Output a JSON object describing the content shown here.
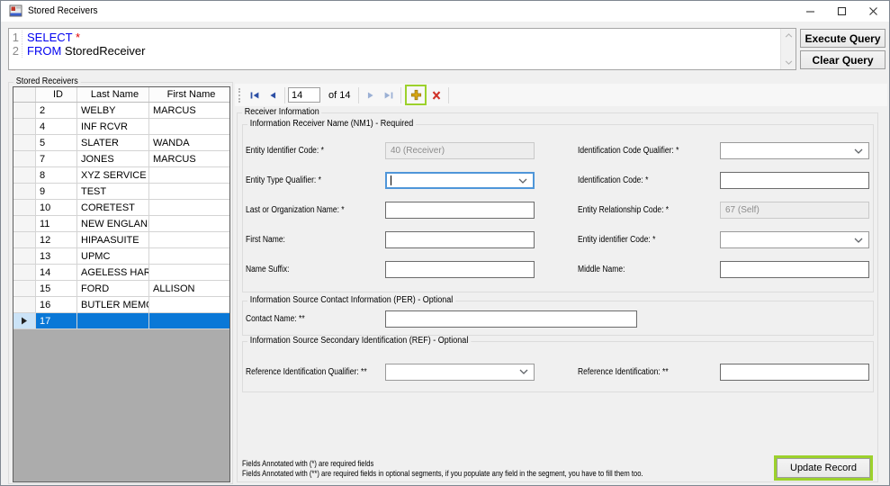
{
  "window": {
    "title": "Stored Receivers"
  },
  "colors": {
    "selection_blue": "#0a78d7",
    "highlight_green": "#9cd12c",
    "nav_arrow_blue": "#2d4fa5",
    "nav_arrow_disabled": "#9bb0d4",
    "add_gold": "#dba812",
    "delete_red": "#d03228",
    "keyword_blue": "#0000f0",
    "star_red": "#e00000"
  },
  "query": {
    "lines": [
      {
        "num": "1",
        "parts": [
          {
            "t": "SELECT",
            "c": "keyword"
          },
          {
            "t": " *",
            "c": "star"
          }
        ]
      },
      {
        "num": "2",
        "parts": [
          {
            "t": "FROM",
            "c": "keyword"
          },
          {
            "t": " StoredReceiver",
            "c": "plain"
          }
        ]
      }
    ],
    "execute_label": "Execute Query",
    "clear_label": "Clear Query"
  },
  "grid": {
    "group_label": "Stored Receivers",
    "columns": [
      "ID",
      "Last Name",
      "First Name"
    ],
    "rows": [
      {
        "id": "2",
        "last": "WELBY",
        "first": "MARCUS"
      },
      {
        "id": "4",
        "last": "INF RCVR",
        "first": ""
      },
      {
        "id": "5",
        "last": "SLATER",
        "first": "WANDA"
      },
      {
        "id": "7",
        "last": "JONES",
        "first": "MARCUS"
      },
      {
        "id": "8",
        "last": "XYZ SERVICE",
        "first": ""
      },
      {
        "id": "9",
        "last": "TEST",
        "first": ""
      },
      {
        "id": "10",
        "last": "CORETEST",
        "first": ""
      },
      {
        "id": "11",
        "last": "NEW ENGLAND...",
        "first": ""
      },
      {
        "id": "12",
        "last": "HIPAASUITE",
        "first": ""
      },
      {
        "id": "13",
        "last": "UPMC",
        "first": ""
      },
      {
        "id": "14",
        "last": "AGELESS HAR...",
        "first": ""
      },
      {
        "id": "15",
        "last": "FORD",
        "first": "ALLISON"
      },
      {
        "id": "16",
        "last": "BUTLER MEMO...",
        "first": ""
      },
      {
        "id": "17",
        "last": "",
        "first": ""
      }
    ],
    "selected_id": "17"
  },
  "navigator": {
    "position": "14",
    "of_label": "of 14"
  },
  "form": {
    "group_label": "Receiver Information",
    "nm1": {
      "label": "Information Receiver Name (NM1) - Required",
      "fields": [
        {
          "label": "Entity Identifier Code: *",
          "name": "entity-identifier-code",
          "control": "text",
          "state": "disabled",
          "value": "40 (Receiver)",
          "col": 0,
          "row": 0
        },
        {
          "label": "Entity Type Qualifier: *",
          "name": "entity-type-qualifier",
          "control": "combo",
          "state": "focused",
          "value": "",
          "col": 0,
          "row": 1
        },
        {
          "label": "Last or Organization Name: *",
          "name": "last-or-organization-name",
          "control": "text",
          "state": "normal",
          "value": "",
          "col": 0,
          "row": 2
        },
        {
          "label": "First Name:",
          "name": "first-name",
          "control": "text",
          "state": "normal",
          "value": "",
          "col": 0,
          "row": 3
        },
        {
          "label": "Name Suffix:",
          "name": "name-suffix",
          "control": "text",
          "state": "normal",
          "value": "",
          "col": 0,
          "row": 4
        },
        {
          "label": "Identification Code Qualifier: *",
          "name": "identification-code-qualifier",
          "control": "combo",
          "state": "normal",
          "value": "",
          "col": 1,
          "row": 0
        },
        {
          "label": "Identification Code: *",
          "name": "identification-code",
          "control": "text",
          "state": "normal",
          "value": "",
          "col": 1,
          "row": 1
        },
        {
          "label": "Entity Relationship Code: *",
          "name": "entity-relationship-code",
          "control": "text",
          "state": "disabled",
          "value": "67 (Self)",
          "col": 1,
          "row": 2
        },
        {
          "label": "Entity identifier Code: *",
          "name": "entity-identifier-code-2",
          "control": "combo",
          "state": "normal",
          "value": "",
          "col": 1,
          "row": 3
        },
        {
          "label": "Middle Name:",
          "name": "middle-name",
          "control": "text",
          "state": "normal",
          "value": "",
          "col": 1,
          "row": 4
        }
      ]
    },
    "per": {
      "label": "Information Source Contact Information (PER) - Optional",
      "fields": [
        {
          "label": "Contact Name: **",
          "name": "contact-name",
          "control": "text",
          "state": "normal",
          "value": "",
          "col": 0,
          "row": 0,
          "wide": true
        }
      ]
    },
    "ref": {
      "label": "Information Source Secondary Identification (REF) - Optional",
      "fields": [
        {
          "label": "Reference Identification Qualifier: **",
          "name": "reference-identification-qualifier",
          "control": "combo",
          "state": "normal",
          "value": "",
          "col": 0,
          "row": 0
        },
        {
          "label": "Reference Identification: **",
          "name": "reference-identification",
          "control": "text",
          "state": "normal",
          "value": "",
          "col": 1,
          "row": 0
        }
      ]
    },
    "footnotes": [
      "Fields Annotated with (*) are required fields",
      "Fields Annotated with (**) are required fields in optional segments, if you populate any field in the segment, you have to fill them too."
    ],
    "update_label": "Update Record"
  }
}
